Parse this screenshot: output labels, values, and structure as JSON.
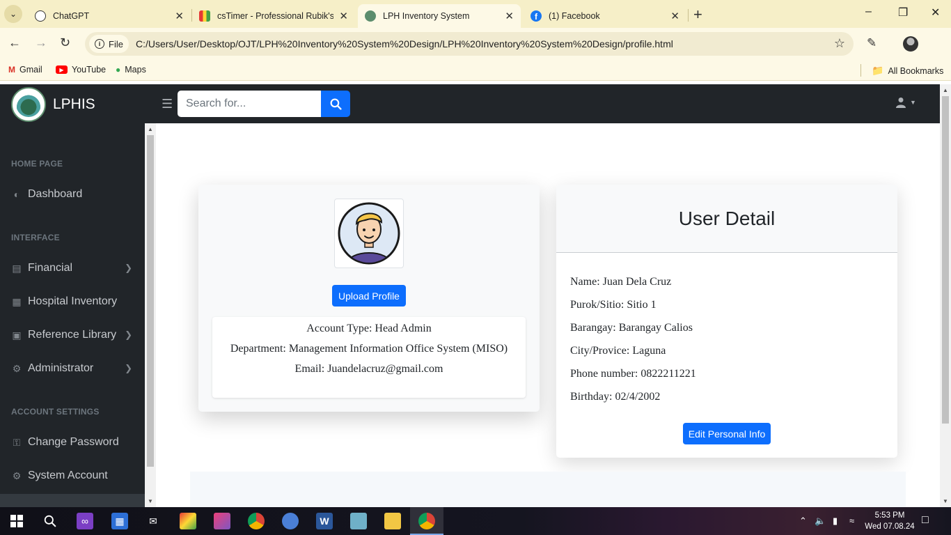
{
  "browser": {
    "tabs": [
      {
        "title": "ChatGPT",
        "icon": "chatgpt-icon"
      },
      {
        "title": "csTimer - Professional Rubik's C",
        "icon": "cstimer-icon"
      },
      {
        "title": "LPH Inventory System",
        "icon": "lph-icon",
        "active": true
      },
      {
        "title": "(1) Facebook",
        "icon": "facebook-icon"
      }
    ],
    "site_chip": "File",
    "url": "C:/Users/User/Desktop/OJT/LPH%20Inventory%20System%20Design/LPH%20Inventory%20System%20Design/profile.html",
    "bookmarks": [
      {
        "label": "Gmail",
        "icon": "gmail-icon"
      },
      {
        "label": "YouTube",
        "icon": "youtube-icon"
      },
      {
        "label": "Maps",
        "icon": "maps-icon"
      }
    ],
    "all_bookmarks": "All Bookmarks"
  },
  "app": {
    "brand": "LPHIS",
    "search": {
      "placeholder": "Search for..."
    },
    "sidebar": {
      "headings": [
        "HOME PAGE",
        "INTERFACE",
        "ACCOUNT SETTINGS"
      ],
      "items": [
        {
          "label": "Dashboard",
          "icon": "dashboard-icon",
          "has_submenu": false
        },
        {
          "label": "Financial",
          "icon": "money-icon",
          "has_submenu": true
        },
        {
          "label": "Hospital Inventory",
          "icon": "building-icon",
          "has_submenu": false
        },
        {
          "label": "Reference Library",
          "icon": "book-icon",
          "has_submenu": true
        },
        {
          "label": "Administrator",
          "icon": "user-gear-icon",
          "has_submenu": true
        },
        {
          "label": "Change Password",
          "icon": "key-icon",
          "has_submenu": false
        },
        {
          "label": "System Account",
          "icon": "cogs-icon",
          "has_submenu": false
        }
      ]
    },
    "profile": {
      "upload_button": "Upload Profile",
      "account_type": "Account Type: Head Admin",
      "department": "Department: Management Information Office System (MISO)",
      "email": "Email: Juandelacruz@gmail.com"
    },
    "user_detail": {
      "title": "User Detail",
      "fields": [
        "Name: Juan Dela Cruz",
        "Purok/Sitio: Sitio 1",
        "Barangay: Barangay Calios",
        "City/Provice: Laguna",
        "Phone number: 0822211221",
        "Birthday: 02/4/2002"
      ],
      "edit_button": "Edit Personal Info"
    }
  },
  "taskbar": {
    "time": "5:53 PM",
    "date": "Wed 07.08.24"
  },
  "colors": {
    "primary": "#0d6efd",
    "nav_dark": "#212529",
    "chrome_frame": "#f6efc8"
  }
}
